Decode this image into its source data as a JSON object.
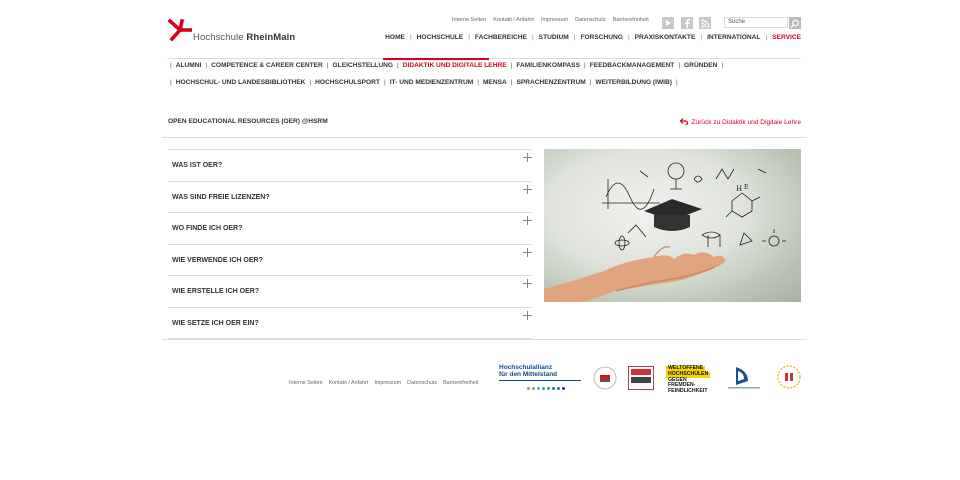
{
  "header": {
    "logo": {
      "name_plain": "Hochschule ",
      "name_bold": "RheinMain"
    },
    "metanav": [
      "Interne Seiten",
      "Kontakt / Anfahrt",
      "Impressum",
      "Datenschutz",
      "Barrierefreiheit"
    ],
    "search": {
      "placeholder": "Suche"
    },
    "social": [
      "youtube-icon",
      "facebook-icon",
      "rss-icon"
    ],
    "mainnav": [
      "HOME",
      "HOCHSCHULE",
      "FACHBEREICHE",
      "STUDIUM",
      "FORSCHUNG",
      "PRAXISKONTAKTE",
      "INTERNATIONAL",
      "SERVICE"
    ],
    "mainnav_active": "SERVICE"
  },
  "subnav": {
    "row1": [
      "ALUMNI",
      "COMPETENCE & CAREER CENTER",
      "GLEICHSTELLUNG",
      "DIDAKTIK UND DIGITALE LEHRE",
      "FAMILIENKOMPASS",
      "FEEDBACKMANAGEMENT",
      "GRÜNDEN"
    ],
    "row2": [
      "HOCHSCHUL- UND LANDESBIBLIOTHEK",
      "HOCHSCHULSPORT",
      "IT- UND MEDIENZENTRUM",
      "MENSA",
      "SPRACHENZENTRUM",
      "WEITERBILDUNG (IWIB)"
    ],
    "active": "DIDAKTIK UND DIGITALE LEHRE"
  },
  "page": {
    "title": "OPEN EDUCATIONAL RESOURCES (OER) @HSRM",
    "back_link": "Zurück zu Didaktik und Digitale Lehre"
  },
  "accordion": [
    "WAS IST OER?",
    "WAS SIND FREIE LIZENZEN?",
    "WO FINDE ICH OER?",
    "WIE VERWENDE ICH OER?",
    "WIE ERSTELLE ICH OER?",
    "WIE SETZE ICH OER EIN?"
  ],
  "footer": {
    "nav": [
      "Interne Seiten",
      "Kontakt / Anfahrt",
      "Impressum",
      "Datenschutz",
      "Barrierefreiheit"
    ],
    "logos": {
      "hochschulallianz": [
        "Hochschulallianz",
        "für den Mittelstand"
      ],
      "weltoffene": [
        "WELTOFFENE",
        "HOCHSCHULEN",
        "GEGEN FREMDEN-",
        "FEINDLICHKEIT"
      ]
    }
  },
  "colors": {
    "accent": "#d8001c",
    "text": "#333333",
    "line": "#dddddd"
  }
}
